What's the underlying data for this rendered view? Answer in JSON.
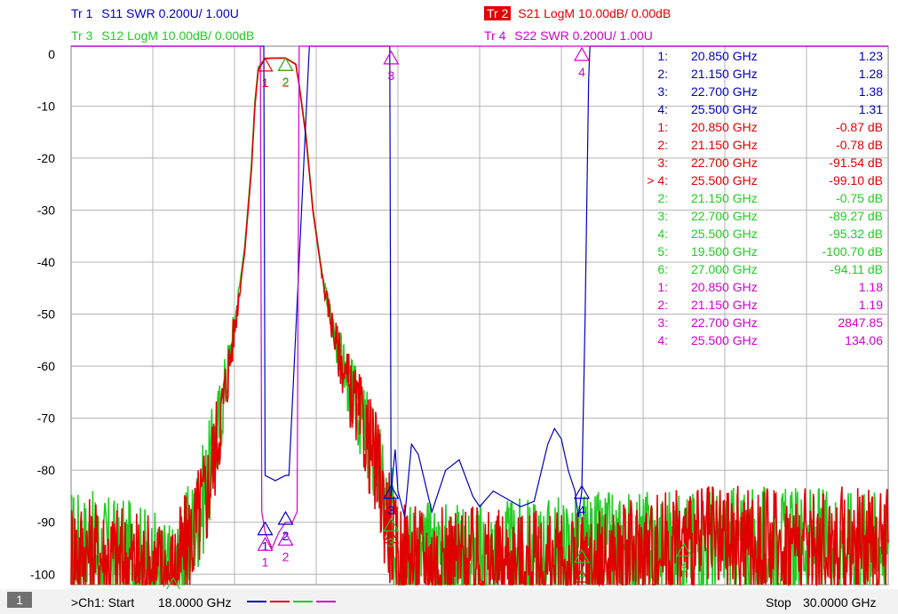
{
  "headers": {
    "tr1": {
      "label": "Tr  1",
      "text": "S11 SWR 0.200U/  1.00U",
      "color": "#0000c0"
    },
    "tr2": {
      "label": "Tr  2",
      "text": "S21 LogM 10.00dB/  0.00dB",
      "color": "#e00000"
    },
    "tr3": {
      "label": "Tr  3",
      "text": "S12 LogM 10.00dB/  0.00dB",
      "color": "#22cc22"
    },
    "tr4": {
      "label": "Tr  4",
      "text": "S22 SWR 0.200U/  1.00U",
      "color": "#d000d0"
    }
  },
  "footer": {
    "channel_number": "1",
    "start_label": ">Ch1:  Start",
    "start_value": "18.0000 GHz",
    "stop_label": "Stop",
    "stop_value": "30.0000 GHz"
  },
  "colors": {
    "s11": "#0000c0",
    "s21": "#e00000",
    "s12": "#22cc22",
    "s22": "#d000d0",
    "grid": "#b4b4b4"
  },
  "chart_data": {
    "type": "line",
    "x_unit": "GHz",
    "xlim": [
      18.0,
      30.0
    ],
    "ylim": [
      -102,
      1.5
    ],
    "y_ticks": [
      0,
      -10,
      -20,
      -30,
      -40,
      -50,
      -60,
      -70,
      -80,
      -90,
      -100
    ],
    "y_tick_labels": [
      "0",
      "-10",
      "-20",
      "-30",
      "-40",
      "-50",
      "-60",
      "-70",
      "-80",
      "-90",
      "-100"
    ],
    "grid": true,
    "series": [
      {
        "name": "S11 SWR",
        "key": "s11",
        "color": "#0000c0",
        "x": [
          18.0,
          20.83,
          20.85,
          21.0,
          21.15,
          21.2,
          21.5,
          22.68,
          22.7,
          22.73,
          22.76,
          22.8,
          22.9,
          23.0,
          23.1,
          23.3,
          23.5,
          23.7,
          23.9,
          24.0,
          24.2,
          24.4,
          24.6,
          24.8,
          25.0,
          25.1,
          25.2,
          25.3,
          25.4,
          25.45,
          25.5,
          25.55,
          25.6,
          25.62,
          30.0
        ],
        "y": [
          1.5,
          1.5,
          -81,
          -82,
          -81,
          -81,
          1.5,
          1.5,
          -85,
          -80,
          -76,
          -84,
          -89,
          -75,
          -77,
          -88,
          -80,
          -78,
          -85,
          -87,
          -84,
          -85.5,
          -87,
          -86,
          -75,
          -72,
          -74,
          -80,
          -84,
          -89,
          -84,
          -50,
          -5,
          1.5,
          1.5
        ]
      },
      {
        "name": "S21 LogM",
        "key": "s21",
        "color": "#e00000",
        "x": [
          18.0,
          19.0,
          19.5,
          19.8,
          20.0,
          20.2,
          20.4,
          20.55,
          20.65,
          20.7,
          20.75,
          20.85,
          21.0,
          21.15,
          21.3,
          21.35,
          21.45,
          21.55,
          21.7,
          21.9,
          22.1,
          22.3,
          22.5,
          22.6,
          22.7,
          22.75,
          23.0,
          24.0,
          25.5,
          27.0,
          30.0
        ],
        "y": [
          -95,
          -98,
          -100,
          -92,
          -84,
          -70,
          -53,
          -38,
          -22,
          -10,
          -3,
          -0.87,
          -0.8,
          -0.78,
          -2,
          -6,
          -16,
          -30,
          -44,
          -56,
          -65,
          -72,
          -80,
          -87,
          -91.54,
          -96,
          -97,
          -98,
          -99.1,
          -94,
          -94
        ]
      },
      {
        "name": "S12 LogM",
        "key": "s12",
        "color": "#22cc22",
        "x": [
          18.0,
          19.0,
          19.5,
          19.8,
          20.0,
          20.2,
          20.4,
          20.55,
          20.65,
          20.7,
          20.75,
          20.85,
          21.0,
          21.15,
          21.3,
          21.35,
          21.45,
          21.55,
          21.7,
          21.9,
          22.1,
          22.3,
          22.5,
          22.6,
          22.7,
          22.75,
          23.0,
          24.0,
          25.5,
          27.0,
          30.0
        ],
        "y": [
          -94,
          -97,
          -100.7,
          -91,
          -83,
          -69,
          -52,
          -37,
          -21,
          -9,
          -2.5,
          -0.8,
          -0.77,
          -0.75,
          -1.9,
          -5.8,
          -15.5,
          -29.5,
          -43.5,
          -55.5,
          -64.5,
          -71.5,
          -79.5,
          -86.5,
          -89.27,
          -95,
          -96,
          -97,
          -95.32,
          -94.11,
          -94
        ]
      },
      {
        "name": "S22 SWR",
        "key": "s22",
        "color": "#d000d0",
        "x": [
          18.0,
          20.78,
          20.8,
          20.85,
          20.95,
          21.05,
          21.15,
          21.25,
          21.32,
          21.35,
          30.0
        ],
        "y": [
          1.5,
          1.5,
          -88,
          -92,
          -95,
          -92,
          -90,
          -90,
          -88,
          1.5,
          1.5
        ]
      }
    ],
    "markers": [
      {
        "series": "s21",
        "label": "1",
        "x": 20.85,
        "y": -0.87
      },
      {
        "series": "s21",
        "label": "2",
        "x": 21.15,
        "y": -0.78
      },
      {
        "series": "s21",
        "label": "3",
        "x": 22.7,
        "y": -91.54
      },
      {
        "series": "s21",
        "label": "4",
        "x": 25.5,
        "y": -99.1
      },
      {
        "series": "s12",
        "label": "2",
        "x": 21.15,
        "y": -0.75
      },
      {
        "series": "s12",
        "label": "3",
        "x": 22.7,
        "y": -89.27
      },
      {
        "series": "s12",
        "label": "4",
        "x": 25.5,
        "y": -95.32
      },
      {
        "series": "s12",
        "label": "5",
        "x": 19.5,
        "y": -100.7
      },
      {
        "series": "s12",
        "label": "6",
        "x": 27.0,
        "y": -94.11
      },
      {
        "series": "s11",
        "label": "1",
        "x": 20.85,
        "y": -90
      },
      {
        "series": "s11",
        "label": "2",
        "x": 21.15,
        "y": -88
      },
      {
        "series": "s11",
        "label": "3",
        "x": 22.7,
        "y": -83
      },
      {
        "series": "s11",
        "label": "4",
        "x": 25.5,
        "y": -83
      },
      {
        "series": "s22",
        "label": "1",
        "x": 20.85,
        "y": -93
      },
      {
        "series": "s22",
        "label": "2",
        "x": 21.15,
        "y": -92
      },
      {
        "series": "s22",
        "label": "3",
        "x": 22.7,
        "y": 0.5
      },
      {
        "series": "s22",
        "label": "4",
        "x": 25.5,
        "y": 1.5
      }
    ],
    "marker_table": [
      {
        "num": "1:",
        "freq": "20.850  GHz",
        "value": "1.23",
        "color": "#0000c0"
      },
      {
        "num": "2:",
        "freq": "21.150  GHz",
        "value": "1.28",
        "color": "#0000c0"
      },
      {
        "num": "3:",
        "freq": "22.700  GHz",
        "value": "1.38",
        "color": "#0000c0"
      },
      {
        "num": "4:",
        "freq": "25.500  GHz",
        "value": "1.31",
        "color": "#0000c0"
      },
      {
        "num": "1:",
        "freq": "20.850  GHz",
        "value": "-0.87 dB",
        "color": "#e00000"
      },
      {
        "num": "2:",
        "freq": "21.150  GHz",
        "value": "-0.78 dB",
        "color": "#e00000"
      },
      {
        "num": "3:",
        "freq": "22.700  GHz",
        "value": "-91.54 dB",
        "color": "#e00000"
      },
      {
        "num": "> 4:",
        "freq": "25.500  GHz",
        "value": "-99.10 dB",
        "color": "#e00000"
      },
      {
        "num": "2:",
        "freq": "21.150  GHz",
        "value": "-0.75 dB",
        "color": "#22cc22"
      },
      {
        "num": "3:",
        "freq": "22.700  GHz",
        "value": "-89.27 dB",
        "color": "#22cc22"
      },
      {
        "num": "4:",
        "freq": "25.500  GHz",
        "value": "-95.32 dB",
        "color": "#22cc22"
      },
      {
        "num": "5:",
        "freq": "19.500  GHz",
        "value": "-100.70 dB",
        "color": "#22cc22"
      },
      {
        "num": "6:",
        "freq": "27.000  GHz",
        "value": "-94.11 dB",
        "color": "#22cc22"
      },
      {
        "num": "1:",
        "freq": "20.850  GHz",
        "value": "1.18",
        "color": "#d000d0"
      },
      {
        "num": "2:",
        "freq": "21.150  GHz",
        "value": "1.19",
        "color": "#d000d0"
      },
      {
        "num": "3:",
        "freq": "22.700  GHz",
        "value": "2847.85",
        "color": "#d000d0"
      },
      {
        "num": "4:",
        "freq": "25.500  GHz",
        "value": "134.06",
        "color": "#d000d0"
      }
    ]
  }
}
